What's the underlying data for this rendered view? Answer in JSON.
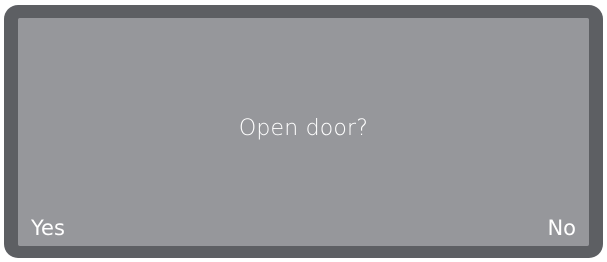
{
  "dialog": {
    "prompt": "Open door?",
    "softkeys": {
      "left_label": "Yes",
      "right_label": "No"
    }
  },
  "colors": {
    "frame": "#5d5f63",
    "screen": "#96979b",
    "text": "#ffffff"
  }
}
